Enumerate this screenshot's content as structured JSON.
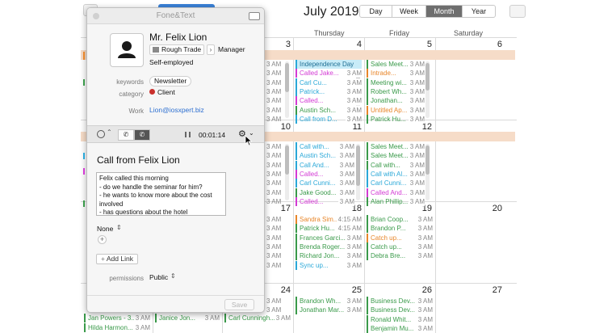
{
  "calendar": {
    "title": "July 2019",
    "views": [
      "Day",
      "Week",
      "Month",
      "Year"
    ],
    "active_view": "Month",
    "weekdays": [
      "Thursday",
      "Friday",
      "Saturday"
    ],
    "day_numbers": {
      "week1": [
        "3",
        "4",
        "5",
        "6"
      ],
      "week2": [
        "10",
        "11",
        "12"
      ],
      "week3": [
        "17",
        "18",
        "19",
        "20"
      ],
      "week4": [
        "24",
        "25",
        "26",
        "27"
      ]
    },
    "time_col_week1": [
      "3 AM",
      "3 AM",
      "3 AM",
      "3 AM",
      "3 AM",
      "3 AM",
      "3 AM"
    ],
    "time_col_week2": [
      "3 AM",
      "3 AM",
      "3 AM",
      "3 AM",
      "3 AM",
      "3 AM",
      "3 AM"
    ],
    "time_col_week3": [
      "3 AM",
      "3 AM",
      "3 AM",
      "3 AM",
      "3 AM",
      "3 AM"
    ],
    "time_col_week4": [
      "3 AM",
      "3 AM"
    ],
    "thu_week1": [
      {
        "text": "Independence Day",
        "time": "",
        "color": "#2aa8d8",
        "bg": "#c8ecf8"
      },
      {
        "text": "Called Jake...",
        "time": "3 AM",
        "color": "#d33ad4"
      },
      {
        "text": "Carl Cu...",
        "time": "3 AM",
        "color": "#2aa8d8"
      },
      {
        "text": "Patrick...",
        "time": "3 AM",
        "color": "#2aa8d8"
      },
      {
        "text": "Called...",
        "time": "3 AM",
        "color": "#d33ad4"
      },
      {
        "text": "Austin Sch...",
        "time": "3 AM",
        "color": "#3a9a4a"
      },
      {
        "text": "Call from D...",
        "time": "3 AM",
        "color": "#2aa8d8"
      }
    ],
    "fri_week1": [
      {
        "text": "Sales Meet...",
        "time": "3 AM",
        "color": "#3a9a4a"
      },
      {
        "text": "Intrade...",
        "time": "3 AM",
        "color": "#e8862a"
      },
      {
        "text": "Meeting wi...",
        "time": "3 AM",
        "color": "#3a9a4a"
      },
      {
        "text": "Robert Wh...",
        "time": "3 AM",
        "color": "#3a9a4a"
      },
      {
        "text": "Jonathan...",
        "time": "3 AM",
        "color": "#3a9a4a"
      },
      {
        "text": "Untitled Ap...",
        "time": "3 AM",
        "color": "#e8862a"
      },
      {
        "text": "Patrick Hu...",
        "time": "3 AM",
        "color": "#3a9a4a"
      }
    ],
    "thu_week2": [
      {
        "text": "Call with...",
        "time": "3 AM",
        "color": "#2aa8d8"
      },
      {
        "text": "Austin Sch...",
        "time": "3 AM",
        "color": "#2aa8d8"
      },
      {
        "text": "Call And...",
        "time": "3 AM",
        "color": "#2aa8d8"
      },
      {
        "text": "Called...",
        "time": "3 AM",
        "color": "#d33ad4"
      },
      {
        "text": "Carl Cunni...",
        "time": "3 AM",
        "color": "#2aa8d8"
      },
      {
        "text": "Jake Good...",
        "time": "3 AM",
        "color": "#3a9a4a"
      },
      {
        "text": "Called...",
        "time": "3 AM",
        "color": "#d33ad4"
      }
    ],
    "fri_week2": [
      {
        "text": "Sales Meet...",
        "time": "3 AM",
        "color": "#3a9a4a"
      },
      {
        "text": "Sales Meet...",
        "time": "3 AM",
        "color": "#3a9a4a"
      },
      {
        "text": "Call with...",
        "time": "3 AM",
        "color": "#3a9a4a"
      },
      {
        "text": "Call with Al...",
        "time": "3 AM",
        "color": "#2aa8d8"
      },
      {
        "text": "Carl Cunni...",
        "time": "3 AM",
        "color": "#2aa8d8"
      },
      {
        "text": "Called And...",
        "time": "3 AM",
        "color": "#d33ad4"
      },
      {
        "text": "Alan Phillip...",
        "time": "3 AM",
        "color": "#3a9a4a"
      }
    ],
    "thu_week3": [
      {
        "text": "Sandra Sim...",
        "time": "4:15 AM",
        "color": "#e8862a"
      },
      {
        "text": "Patrick Hu...",
        "time": "4:15 AM",
        "color": "#3a9a4a"
      },
      {
        "text": "Frances Garci...",
        "time": "3 AM",
        "color": "#3a9a4a"
      },
      {
        "text": "Brenda Roger...",
        "time": "3 AM",
        "color": "#3a9a4a"
      },
      {
        "text": "Richard Jon...",
        "time": "3 AM",
        "color": "#3a9a4a"
      },
      {
        "text": "Sync up...",
        "time": "3 AM",
        "color": "#2aa8d8"
      }
    ],
    "fri_week3": [
      {
        "text": "Brian Coop...",
        "time": "3 AM",
        "color": "#3a9a4a"
      },
      {
        "text": "Brandon P...",
        "time": "3 AM",
        "color": "#3a9a4a"
      },
      {
        "text": "Catch up...",
        "time": "3 AM",
        "color": "#e8862a"
      },
      {
        "text": "Catch up...",
        "time": "3 AM",
        "color": "#3a9a4a"
      },
      {
        "text": "Debra Bre...",
        "time": "3 AM",
        "color": "#3a9a4a"
      }
    ],
    "thu_week4": [
      {
        "text": "Brandon Wh...",
        "time": "3 AM",
        "color": "#3a9a4a"
      },
      {
        "text": "Jonathan Mar...",
        "time": "3 AM",
        "color": "#3a9a4a"
      }
    ],
    "fri_week4": [
      {
        "text": "Business Dev...",
        "time": "3 AM",
        "color": "#3a9a4a"
      },
      {
        "text": "Business Dev...",
        "time": "3 AM",
        "color": "#3a9a4a"
      },
      {
        "text": "Ronald Whit...",
        "time": "3 AM",
        "color": "#3a9a4a"
      },
      {
        "text": "Benjamin Mu...",
        "time": "3 AM",
        "color": "#3a9a4a"
      }
    ],
    "bottom_left": [
      {
        "text": "Jan Powers - 3...",
        "time": "3 AM",
        "color": "#3a9a4a"
      },
      {
        "text": "Hilda Harmon...",
        "time": "3 AM",
        "color": "#3a9a4a"
      },
      {
        "text": "Janice Jon...",
        "time": "3 AM",
        "color": "#3a9a4a"
      },
      {
        "text": "Carl Cunningh...",
        "time": "3 AM",
        "color": "#3a9a4a"
      }
    ]
  },
  "panel": {
    "title": "Fone&Text",
    "name": "Mr. Felix Lion",
    "company": "Rough Trade",
    "role": "Manager",
    "employment": "Self-employed",
    "keywords_label": "keywords",
    "keyword": "Newsletter",
    "category_label": "category",
    "category": "Client",
    "work_label": "Work",
    "email": "Lion@iosxpert.biz",
    "timer": "00:01:14",
    "call_title": "Call from Felix Lion",
    "notes": "Felix called this morning\n- do we handle the seminar for him?\n- he wants to know more about the cost\ninvolved\n- has questions about the hotel",
    "priority": "None",
    "add_link": "Add Link",
    "permissions_label": "permissions",
    "permissions": "Public",
    "save": "Save",
    "colors": {
      "link": "#2d6fd0",
      "category_dot": "#c9302c"
    }
  }
}
